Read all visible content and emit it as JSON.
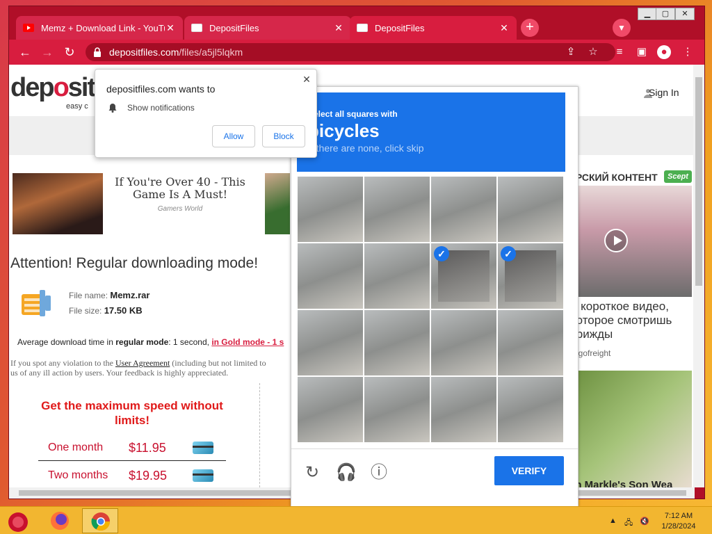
{
  "browser": {
    "tabs": [
      {
        "title": "Memz + Download Link - YouTu",
        "active": false,
        "icon": "youtube-favicon"
      },
      {
        "title": "DepositFiles",
        "active": false,
        "icon": "depositfiles-favicon"
      },
      {
        "title": "DepositFiles",
        "active": true,
        "icon": "depositfiles-favicon"
      }
    ],
    "url_host": "depositfiles.com",
    "url_path": "/files/a5jl5lqkm"
  },
  "notification": {
    "site": "depositfiles.com wants to",
    "message": "Show notifications",
    "allow": "Allow",
    "block": "Block"
  },
  "site": {
    "logo_prefix": "dep",
    "logo_o": "o",
    "logo_suffix": "sit",
    "tagline": "easy c",
    "sign_in": "Sign In"
  },
  "ad": {
    "title": "If You're Over 40 - This Game Is A Must!",
    "source": "Gamers World"
  },
  "download": {
    "attention": "Attention! Regular downloading mode!",
    "file_name_label": "File name:",
    "file_name": "Memz.rar",
    "file_size_label": "File size:",
    "file_size": "17.50 KB",
    "avg_prefix": "Average download time in",
    "regular_mode": "regular mode",
    "avg_mid": ": 1 second,",
    "gold_mode": "in Gold mode - 1 s",
    "violation_1": "If you spot any violation to the",
    "violation_link": "User Agreement",
    "violation_2": "(including but not limited to",
    "violation_3": "us of any ill action by users. Your feedback is highly appreciated.",
    "max_speed": "Get the maximum speed without limits!",
    "plans": [
      {
        "name": "One month",
        "price": "$11.95"
      },
      {
        "name": "Two months",
        "price": "$19.95"
      }
    ]
  },
  "right_ads": {
    "title": "ОРСКИЙ КОНТЕНТ",
    "badge": "Scept",
    "text": "е короткое видео, которое смотришь трижды",
    "source": "argofreight",
    "caption": "an Markle's Son Wea"
  },
  "captcha": {
    "line1": "Select all squares with",
    "object": "bicycles",
    "line3": "If there are none, click skip",
    "verify": "VERIFY",
    "selected_cells": [
      6,
      7
    ],
    "accent": "#1a73e8"
  },
  "taskbar": {
    "time": "7:12 AM",
    "date": "1/28/2024"
  },
  "colors": {
    "chrome_red": "#b00f28",
    "toolbar_red": "#d81d3f",
    "price_red": "#c8102e"
  }
}
